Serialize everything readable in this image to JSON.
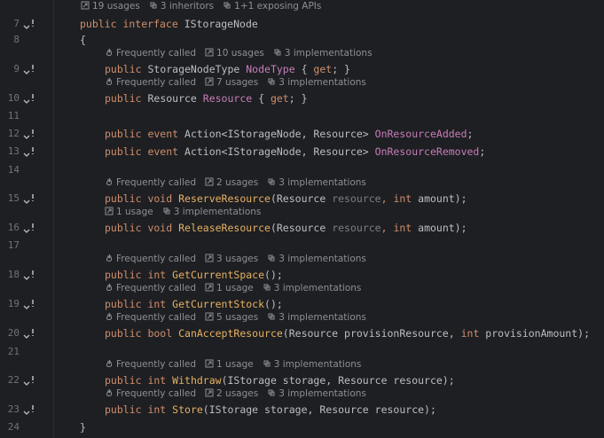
{
  "editor": {
    "lines": [
      {
        "num": "7",
        "code": [
          [
            "kw",
            "public interface "
          ],
          [
            "tx",
            "IStorageNode"
          ]
        ]
      },
      {
        "num": "8",
        "code": [
          [
            "tx",
            "{"
          ]
        ]
      },
      {
        "num": "9",
        "code": [
          [
            "kw",
            "public "
          ],
          [
            "tx",
            "StorageNodeType "
          ],
          [
            "pr",
            "NodeType"
          ],
          [
            "tx",
            " { "
          ],
          [
            "kw",
            "get"
          ],
          [
            "tx",
            "; }"
          ]
        ]
      },
      {
        "num": "10",
        "code": [
          [
            "kw",
            "public "
          ],
          [
            "tx",
            "Resource "
          ],
          [
            "pr",
            "Resource"
          ],
          [
            "tx",
            " { "
          ],
          [
            "kw",
            "get"
          ],
          [
            "tx",
            "; }"
          ]
        ]
      },
      {
        "num": "11",
        "code": []
      },
      {
        "num": "12",
        "code": [
          [
            "kw",
            "public event "
          ],
          [
            "tx",
            "Action<IStorageNode, Resource> "
          ],
          [
            "ev",
            "OnResourceAdded"
          ],
          [
            "tx",
            ";"
          ]
        ]
      },
      {
        "num": "13",
        "code": [
          [
            "kw",
            "public event "
          ],
          [
            "tx",
            "Action<IStorageNode, Resource> "
          ],
          [
            "ev",
            "OnResourceRemoved"
          ],
          [
            "tx",
            ";"
          ]
        ]
      },
      {
        "num": "14",
        "code": []
      },
      {
        "num": "15",
        "code": [
          [
            "kw",
            "public void "
          ],
          [
            "fn",
            "ReserveResource"
          ],
          [
            "tx",
            "(Resource "
          ],
          [
            "pm",
            "resource"
          ],
          [
            "kw",
            ", int "
          ],
          [
            "tx",
            "amount);"
          ]
        ]
      },
      {
        "num": "16",
        "code": [
          [
            "kw",
            "public void "
          ],
          [
            "fn",
            "ReleaseResource"
          ],
          [
            "tx",
            "(Resource "
          ],
          [
            "pm",
            "resource"
          ],
          [
            "kw",
            ", int "
          ],
          [
            "tx",
            "amount);"
          ]
        ]
      },
      {
        "num": "17",
        "code": []
      },
      {
        "num": "18",
        "code": [
          [
            "kw",
            "public int "
          ],
          [
            "fn",
            "GetCurrentSpace"
          ],
          [
            "tx",
            "();"
          ]
        ]
      },
      {
        "num": "19",
        "code": [
          [
            "kw",
            "public int "
          ],
          [
            "fn",
            "GetCurrentStock"
          ],
          [
            "tx",
            "();"
          ]
        ]
      },
      {
        "num": "20",
        "code": [
          [
            "kw",
            "public bool "
          ],
          [
            "fn",
            "CanAcceptResource"
          ],
          [
            "tx",
            "(Resource provisionResource, "
          ],
          [
            "kw",
            "int "
          ],
          [
            "tx",
            "provisionAmount);"
          ]
        ]
      },
      {
        "num": "21",
        "code": []
      },
      {
        "num": "22",
        "code": [
          [
            "kw",
            "public int "
          ],
          [
            "fn",
            "Withdraw"
          ],
          [
            "tx",
            "(IStorage storage, Resource resource);"
          ]
        ]
      },
      {
        "num": "23",
        "code": [
          [
            "kw",
            "public int "
          ],
          [
            "fn",
            "Store"
          ],
          [
            "tx",
            "(IStorage storage, Resource resource);"
          ]
        ]
      },
      {
        "num": "24",
        "code": [
          [
            "tx",
            "}"
          ]
        ]
      }
    ],
    "hints": [
      {
        "line": "7",
        "items": [
          [
            "usage",
            "19 usages"
          ],
          [
            "inherit",
            "3 inheritors"
          ],
          [
            "inherit",
            "1+1 exposing APIs"
          ]
        ]
      },
      {
        "line": "9",
        "items": [
          [
            "flame",
            "Frequently called"
          ],
          [
            "usage",
            "10 usages"
          ],
          [
            "inherit",
            "3 implementations"
          ]
        ]
      },
      {
        "line": "10",
        "items": [
          [
            "flame",
            "Frequently called"
          ],
          [
            "usage",
            "7 usages"
          ],
          [
            "inherit",
            "3 implementations"
          ]
        ]
      },
      {
        "line": "15",
        "items": [
          [
            "flame",
            "Frequently called"
          ],
          [
            "usage",
            "2 usages"
          ],
          [
            "inherit",
            "3 implementations"
          ]
        ]
      },
      {
        "line": "16",
        "items": [
          [
            "usage",
            "1 usage"
          ],
          [
            "inherit",
            "3 implementations"
          ]
        ]
      },
      {
        "line": "18",
        "items": [
          [
            "flame",
            "Frequently called"
          ],
          [
            "usage",
            "3 usages"
          ],
          [
            "inherit",
            "3 implementations"
          ]
        ]
      },
      {
        "line": "19",
        "items": [
          [
            "flame",
            "Frequently called"
          ],
          [
            "usage",
            "1 usage"
          ],
          [
            "inherit",
            "3 implementations"
          ]
        ]
      },
      {
        "line": "20",
        "items": [
          [
            "flame",
            "Frequently called"
          ],
          [
            "usage",
            "5 usages"
          ],
          [
            "inherit",
            "3 implementations"
          ]
        ]
      },
      {
        "line": "22",
        "items": [
          [
            "flame",
            "Frequently called"
          ],
          [
            "usage",
            "1 usage"
          ],
          [
            "inherit",
            "3 implementations"
          ]
        ]
      },
      {
        "line": "23",
        "items": [
          [
            "flame",
            "Frequently called"
          ],
          [
            "usage",
            "2 usages"
          ],
          [
            "inherit",
            "3 implementations"
          ]
        ]
      }
    ],
    "gutter_icon_lines": [
      "7",
      "9",
      "10",
      "12",
      "13",
      "15",
      "16",
      "18",
      "19",
      "20",
      "22",
      "23"
    ]
  }
}
